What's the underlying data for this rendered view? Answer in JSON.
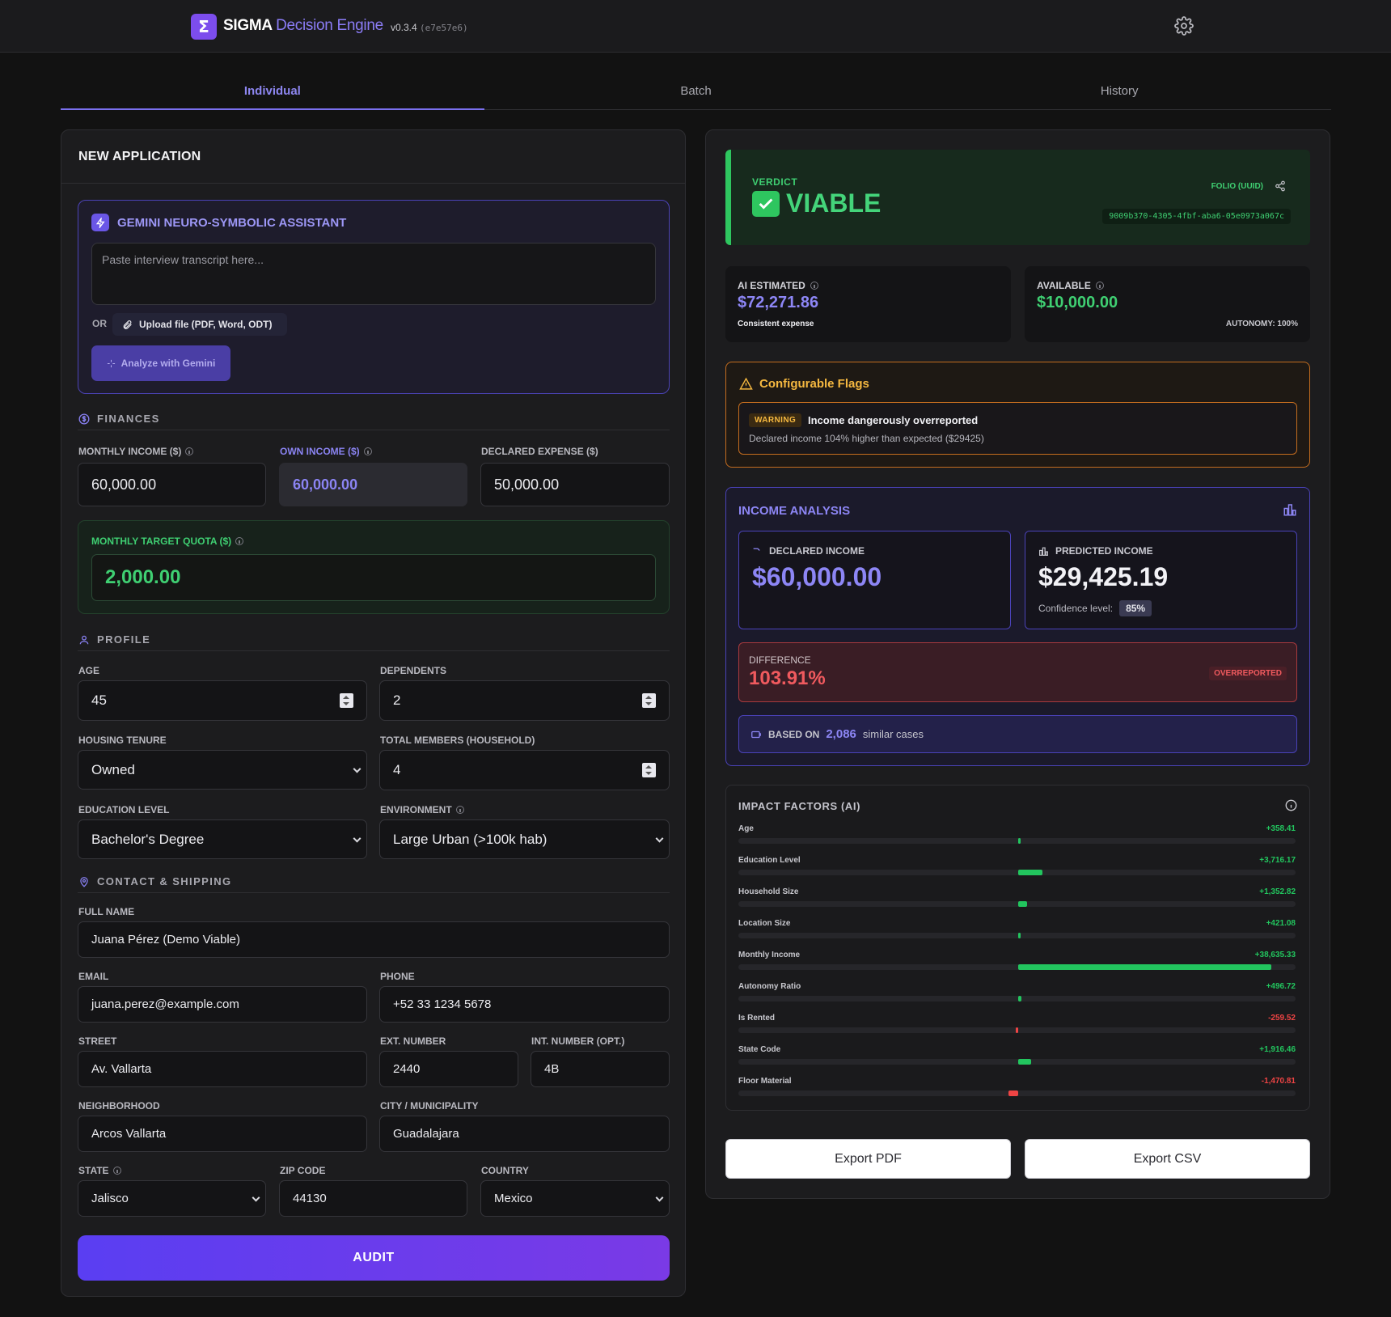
{
  "header": {
    "logo_glyph": "Σ",
    "brand_name": "SIGMA",
    "brand_sub": "Decision Engine",
    "version": "v0.3.4",
    "build_hash": "(e7e57e6)"
  },
  "tabs": [
    "Individual",
    "Batch",
    "History"
  ],
  "form": {
    "title": "NEW APPLICATION",
    "assistant": {
      "title": "GEMINI NEURO-SYMBOLIC ASSISTANT",
      "placeholder": "Paste interview transcript here...",
      "or_label": "OR",
      "upload_label": "Upload file (PDF, Word, ODT)",
      "analyze_label": "Analyze with Gemini"
    },
    "finances": {
      "section": "FINANCES",
      "monthly_income_label": "MONTHLY INCOME ($)",
      "monthly_income": "60,000.00",
      "own_income_label": "OWN INCOME ($)",
      "own_income": "60,000.00",
      "declared_expense_label": "DECLARED EXPENSE ($)",
      "declared_expense": "50,000.00",
      "quota_label": "MONTHLY TARGET QUOTA ($)",
      "quota": "2,000.00"
    },
    "profile": {
      "section": "PROFILE",
      "age_label": "AGE",
      "age": "45",
      "dependents_label": "DEPENDENTS",
      "dependents": "2",
      "housing_label": "HOUSING TENURE",
      "housing": "Owned",
      "members_label": "TOTAL MEMBERS (HOUSEHOLD)",
      "members": "4",
      "education_label": "EDUCATION LEVEL",
      "education": "Bachelor's Degree",
      "environment_label": "ENVIRONMENT",
      "environment": "Large Urban (>100k hab)"
    },
    "contact": {
      "section": "CONTACT & SHIPPING",
      "name_label": "FULL NAME",
      "name": "Juana Pérez (Demo Viable)",
      "email_label": "EMAIL",
      "email": "juana.perez@example.com",
      "phone_label": "PHONE",
      "phone": "+52 33 1234 5678",
      "street_label": "STREET",
      "street": "Av. Vallarta",
      "ext_label": "EXT. NUMBER",
      "ext": "2440",
      "int_label": "INT. NUMBER (OPT.)",
      "int": "4B",
      "neighborhood_label": "NEIGHBORHOOD",
      "neighborhood": "Arcos Vallarta",
      "city_label": "CITY / MUNICIPALITY",
      "city": "Guadalajara",
      "state_label": "STATE",
      "state": "Jalisco",
      "zip_label": "ZIP CODE",
      "zip": "44130",
      "country_label": "COUNTRY",
      "country": "Mexico"
    },
    "audit_label": "AUDIT"
  },
  "result": {
    "verdict_label": "VERDICT",
    "verdict": "VIABLE",
    "folio_label": "FOLIO (UUID)",
    "folio": "9009b370-4305-4fbf-aba6-05e0973a067c",
    "ai_estimated_label": "AI ESTIMATED",
    "ai_estimated": "$72,271.86",
    "ai_estimated_note": "Consistent expense",
    "available_label": "AVAILABLE",
    "available": "$10,000.00",
    "autonomy": "AUTONOMY: 100%",
    "flags": {
      "title": "Configurable Flags",
      "badge": "WARNING",
      "text": "Income dangerously overreported",
      "desc": "Declared income 104% higher than expected ($29425)"
    },
    "income": {
      "title": "INCOME ANALYSIS",
      "declared_label": "DECLARED INCOME",
      "declared": "$60,000.00",
      "predicted_label": "PREDICTED INCOME",
      "predicted": "$29,425.19",
      "confidence_label": "Confidence level:",
      "confidence": "85%",
      "difference_label": "DIFFERENCE",
      "difference": "103.91%",
      "difference_badge": "OVERREPORTED",
      "based_on_label": "BASED ON",
      "based_on_count": "2,086",
      "based_on_suffix": "similar cases"
    },
    "impact": {
      "title": "IMPACT FACTORS (AI)",
      "max_abs": 38635.33,
      "colors": {
        "positive": "#22c55e",
        "negative": "#ef4444"
      },
      "factors": [
        {
          "name": "Age",
          "label": "+358.41",
          "value": 358.41
        },
        {
          "name": "Education Level",
          "label": "+3,716.17",
          "value": 3716.17
        },
        {
          "name": "Household Size",
          "label": "+1,352.82",
          "value": 1352.82
        },
        {
          "name": "Location Size",
          "label": "+421.08",
          "value": 421.08
        },
        {
          "name": "Monthly Income",
          "label": "+38,635.33",
          "value": 38635.33
        },
        {
          "name": "Autonomy Ratio",
          "label": "+496.72",
          "value": 496.72
        },
        {
          "name": "Is Rented",
          "label": "-259.52",
          "value": -259.52
        },
        {
          "name": "State Code",
          "label": "+1,916.46",
          "value": 1916.46
        },
        {
          "name": "Floor Material",
          "label": "-1,470.81",
          "value": -1470.81
        }
      ]
    },
    "export_pdf": "Export PDF",
    "export_csv": "Export CSV"
  }
}
